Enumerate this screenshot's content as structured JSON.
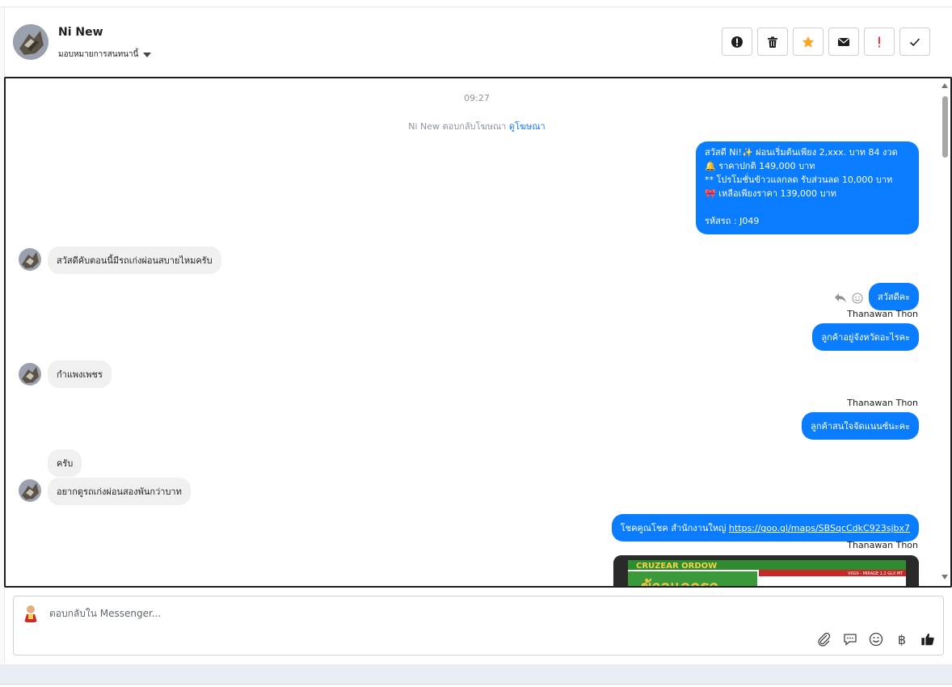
{
  "header": {
    "name": "Ni New",
    "assign_label": "มอบหมายการสนทนานี้"
  },
  "actions": [
    {
      "icon": "alert-circle-icon"
    },
    {
      "icon": "trash-icon"
    },
    {
      "icon": "star-icon",
      "color": "#f5a623"
    },
    {
      "icon": "mail-icon"
    },
    {
      "icon": "exclamation-icon",
      "color": "#fa383e"
    },
    {
      "icon": "check-icon"
    }
  ],
  "chat": {
    "time": "09:27",
    "reply_note": {
      "text": "Ni New ตอบกลับโฆษณา",
      "link": "ดูโฆษณา"
    },
    "ad_message": "สวัสดี Ni!✨  ผ่อนเริ่มต้นเพียง 2,xxx. บาท 84 งวด\n🔔 ราคาปกติ 149,000 บาท\n** โปรโมชั่นข้าวแลกลด รับส่วนลด 10,000 บาท\n🎀  เหลือเพียงราคา 139,000 บาท\n\n รหัสรถ : J049",
    "in_1": "สวัสดีคับตอนนี้มีรถเก่งผ่อนสบายไหมครับ",
    "out_1": "สวัสดีคะ",
    "sender_1": "Thanawan Thon",
    "out_2": "ลูกค้าอยู่จังหวัดอะไรคะ",
    "in_2": "กำแพงเพชร",
    "sender_2": "Thanawan Thon",
    "out_3": "ลูกค้าสนใจจัดแนนซ์นะคะ",
    "in_3": "ครับ",
    "in_4": "อยากดูรถเก่งผ่อนสองพันกว่าบาท",
    "out_4_text": "โชคคูณโชค สำนักงานใหญ่ ",
    "out_4_link": "https://goo.gl/maps/SBSqcCdkC923sjbx7",
    "sender_3": "Thanawan Thon",
    "image_text": "CRUZEAR ORDOW",
    "image_subtext": "V0G0 - MIRAGE 1.2 GLX MT",
    "image_banner": "ข้าวแลกรถ"
  },
  "composer": {
    "placeholder": "ตอบกลับใน Messenger...",
    "tools": [
      "paperclip-icon",
      "saved-reply-icon",
      "emoji-icon",
      "baht-icon",
      "thumbs-up-icon"
    ],
    "baht_symbol": "฿"
  }
}
